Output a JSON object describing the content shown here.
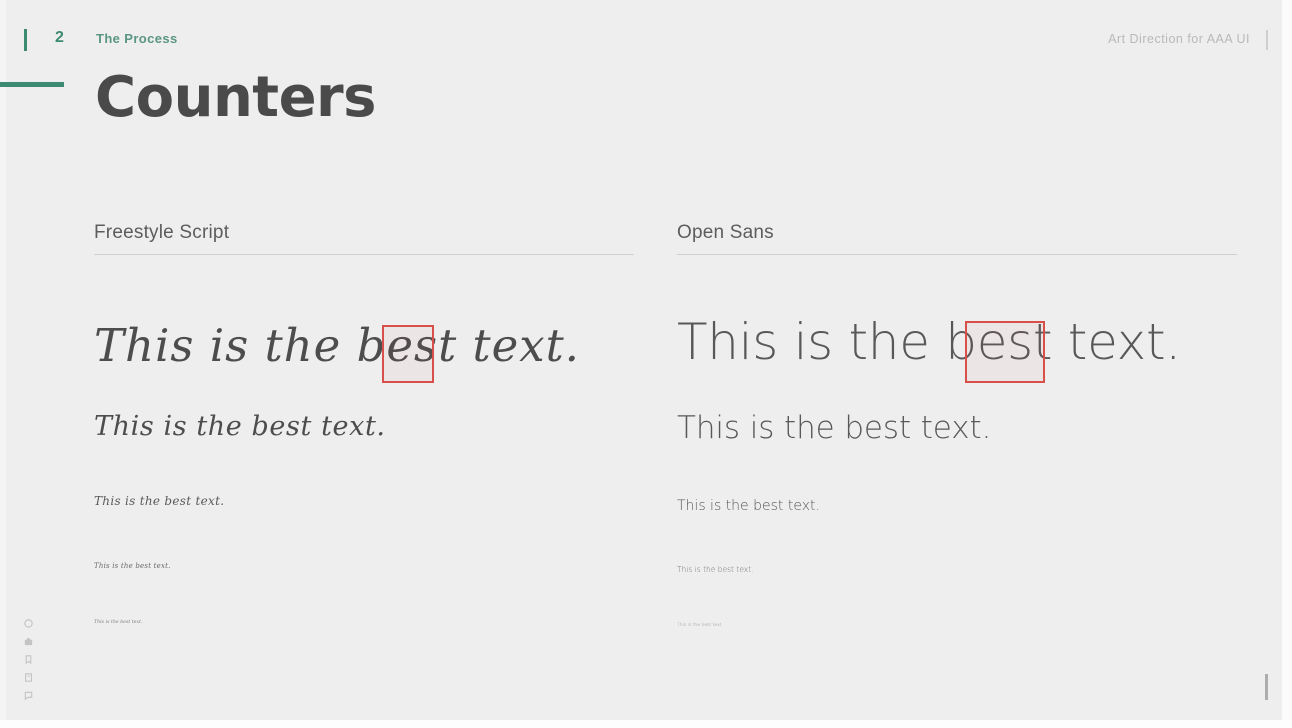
{
  "slide": {
    "background_color": "#eeeeee",
    "accent_color": "#3d8a72",
    "highlight_color": "#d9504a"
  },
  "header": {
    "tick_icon": "vertical-bar-icon",
    "section_number": "2",
    "section_label": "The Process",
    "course_label": "Art Direction for AAA UI",
    "course_tick_icon": "vertical-bar-icon"
  },
  "title": "Counters",
  "columns": [
    {
      "heading": "Freestyle Script",
      "specimens": [
        "This is the best text.",
        "This is the best text.",
        "This is the best text.",
        "This is the best text.",
        "This is the best text."
      ],
      "highlight": {
        "enabled": true,
        "target_letters": "be"
      }
    },
    {
      "heading": "Open Sans",
      "specimens": [
        "This is the best text.",
        "This is the best text.",
        "This is the best text.",
        "This is the best text.",
        "This is the best text."
      ],
      "highlight": {
        "enabled": true,
        "target_letters": "be"
      }
    }
  ],
  "icon_rail": [
    {
      "name": "circle-icon"
    },
    {
      "name": "briefcase-icon"
    },
    {
      "name": "bookmark-icon"
    },
    {
      "name": "note-icon"
    },
    {
      "name": "comment-icon"
    }
  ],
  "page_marker": "vertical-bar-icon"
}
